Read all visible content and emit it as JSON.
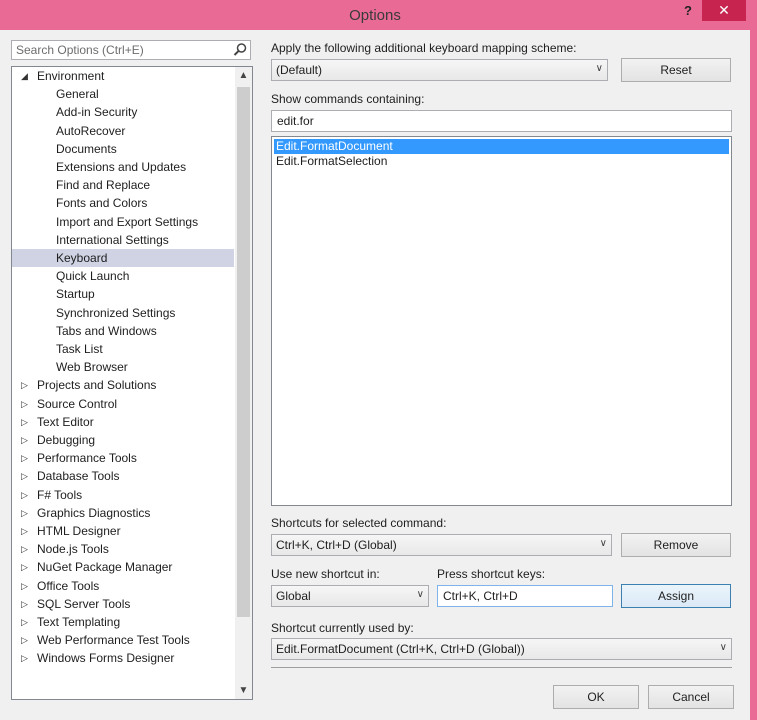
{
  "window": {
    "title": "Options",
    "help_label": "?",
    "close_label": "✕"
  },
  "search": {
    "placeholder": "Search Options (Ctrl+E)"
  },
  "tree": {
    "items": [
      {
        "label": "Environment",
        "level": 0,
        "expanded": true
      },
      {
        "label": "General",
        "level": 1
      },
      {
        "label": "Add-in Security",
        "level": 1
      },
      {
        "label": "AutoRecover",
        "level": 1
      },
      {
        "label": "Documents",
        "level": 1
      },
      {
        "label": "Extensions and Updates",
        "level": 1
      },
      {
        "label": "Find and Replace",
        "level": 1
      },
      {
        "label": "Fonts and Colors",
        "level": 1
      },
      {
        "label": "Import and Export Settings",
        "level": 1
      },
      {
        "label": "International Settings",
        "level": 1
      },
      {
        "label": "Keyboard",
        "level": 1,
        "selected": true
      },
      {
        "label": "Quick Launch",
        "level": 1
      },
      {
        "label": "Startup",
        "level": 1
      },
      {
        "label": "Synchronized Settings",
        "level": 1
      },
      {
        "label": "Tabs and Windows",
        "level": 1
      },
      {
        "label": "Task List",
        "level": 1
      },
      {
        "label": "Web Browser",
        "level": 1
      },
      {
        "label": "Projects and Solutions",
        "level": 0,
        "expanded": false
      },
      {
        "label": "Source Control",
        "level": 0,
        "expanded": false
      },
      {
        "label": "Text Editor",
        "level": 0,
        "expanded": false
      },
      {
        "label": "Debugging",
        "level": 0,
        "expanded": false
      },
      {
        "label": "Performance Tools",
        "level": 0,
        "expanded": false
      },
      {
        "label": "Database Tools",
        "level": 0,
        "expanded": false
      },
      {
        "label": "F# Tools",
        "level": 0,
        "expanded": false
      },
      {
        "label": "Graphics Diagnostics",
        "level": 0,
        "expanded": false
      },
      {
        "label": "HTML Designer",
        "level": 0,
        "expanded": false
      },
      {
        "label": "Node.js Tools",
        "level": 0,
        "expanded": false
      },
      {
        "label": "NuGet Package Manager",
        "level": 0,
        "expanded": false
      },
      {
        "label": "Office Tools",
        "level": 0,
        "expanded": false
      },
      {
        "label": "SQL Server Tools",
        "level": 0,
        "expanded": false
      },
      {
        "label": "Text Templating",
        "level": 0,
        "expanded": false
      },
      {
        "label": "Web Performance Test Tools",
        "level": 0,
        "expanded": false
      },
      {
        "label": "Windows Forms Designer",
        "level": 0,
        "expanded": false
      }
    ]
  },
  "keyboard": {
    "mapping_label": "Apply the following additional keyboard mapping scheme:",
    "mapping_value": "(Default)",
    "reset_label": "Reset",
    "show_commands_label": "Show commands containing:",
    "show_commands_value": "edit.for",
    "commands": [
      {
        "label": "Edit.FormatDocument",
        "selected": true
      },
      {
        "label": "Edit.FormatSelection",
        "selected": false
      }
    ],
    "shortcuts_label": "Shortcuts for selected command:",
    "shortcuts_value": "Ctrl+K, Ctrl+D (Global)",
    "remove_label": "Remove",
    "use_new_label": "Use new shortcut in:",
    "use_new_value": "Global",
    "press_keys_label": "Press shortcut keys:",
    "press_keys_value": "Ctrl+K, Ctrl+D",
    "assign_label": "Assign",
    "used_by_label": "Shortcut currently used by:",
    "used_by_value": "Edit.FormatDocument (Ctrl+K, Ctrl+D (Global))"
  },
  "footer": {
    "ok_label": "OK",
    "cancel_label": "Cancel"
  },
  "colors": {
    "title_bar": "#e96b95",
    "close_button": "#c7254f",
    "selection": "#3399ff",
    "tree_selection": "#cfd3e3"
  }
}
